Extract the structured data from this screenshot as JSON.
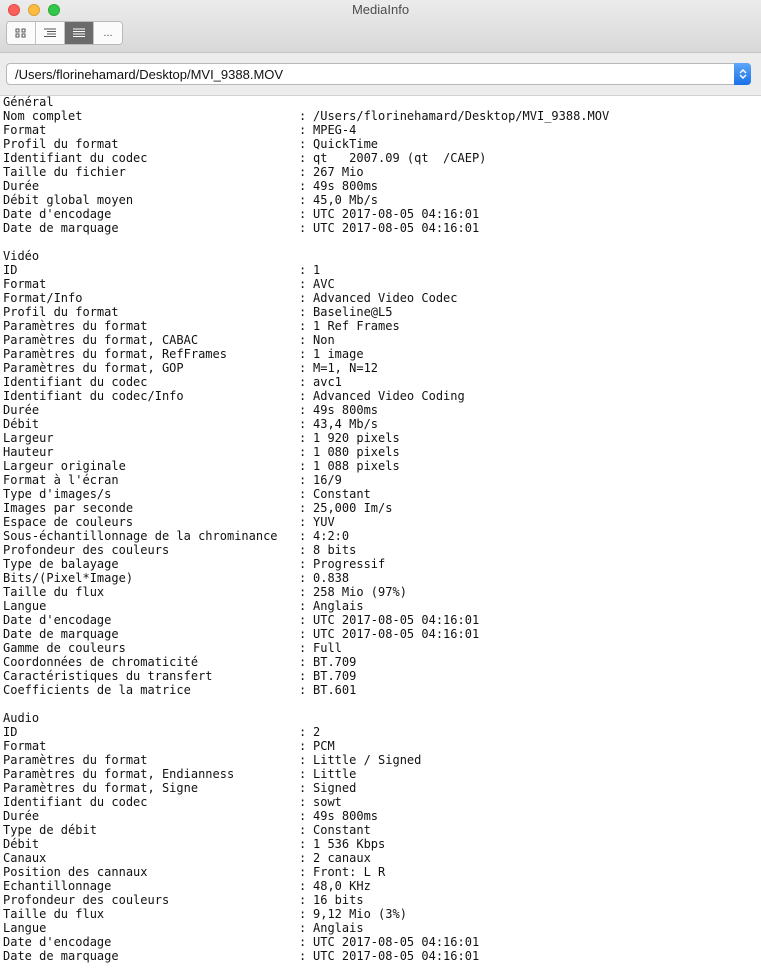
{
  "window": {
    "title": "MediaInfo"
  },
  "toolbar": {
    "more_label": "..."
  },
  "path": {
    "value": "/Users/florinehamard/Desktop/MVI_9388.MOV"
  },
  "separator": ":",
  "sections": [
    {
      "title": "Général",
      "rows": [
        [
          "Nom complet",
          "/Users/florinehamard/Desktop/MVI_9388.MOV"
        ],
        [
          "Format",
          "MPEG-4"
        ],
        [
          "Profil du format",
          "QuickTime"
        ],
        [
          "Identifiant du codec",
          "qt   2007.09 (qt  /CAEP)"
        ],
        [
          "Taille du fichier",
          "267 Mio"
        ],
        [
          "Durée",
          "49s 800ms"
        ],
        [
          "Débit global moyen",
          "45,0 Mb/s"
        ],
        [
          "Date d'encodage",
          "UTC 2017-08-05 04:16:01"
        ],
        [
          "Date de marquage",
          "UTC 2017-08-05 04:16:01"
        ]
      ]
    },
    {
      "title": "Vidéo",
      "rows": [
        [
          "ID",
          "1"
        ],
        [
          "Format",
          "AVC"
        ],
        [
          "Format/Info",
          "Advanced Video Codec"
        ],
        [
          "Profil du format",
          "Baseline@L5"
        ],
        [
          "Paramètres du format",
          "1 Ref Frames"
        ],
        [
          "Paramètres du format, CABAC",
          "Non"
        ],
        [
          "Paramètres du format, RefFrames",
          "1 image"
        ],
        [
          "Paramètres du format, GOP",
          "M=1, N=12"
        ],
        [
          "Identifiant du codec",
          "avc1"
        ],
        [
          "Identifiant du codec/Info",
          "Advanced Video Coding"
        ],
        [
          "Durée",
          "49s 800ms"
        ],
        [
          "Débit",
          "43,4 Mb/s"
        ],
        [
          "Largeur",
          "1 920 pixels"
        ],
        [
          "Hauteur",
          "1 080 pixels"
        ],
        [
          "Largeur originale",
          "1 088 pixels"
        ],
        [
          "Format à l'écran",
          "16/9"
        ],
        [
          "Type d'images/s",
          "Constant"
        ],
        [
          "Images par seconde",
          "25,000 Im/s"
        ],
        [
          "Espace de couleurs",
          "YUV"
        ],
        [
          "Sous-échantillonnage de la chrominance",
          "4:2:0"
        ],
        [
          "Profondeur des couleurs",
          "8 bits"
        ],
        [
          "Type de balayage",
          "Progressif"
        ],
        [
          "Bits/(Pixel*Image)",
          "0.838"
        ],
        [
          "Taille du flux",
          "258 Mio (97%)"
        ],
        [
          "Langue",
          "Anglais"
        ],
        [
          "Date d'encodage",
          "UTC 2017-08-05 04:16:01"
        ],
        [
          "Date de marquage",
          "UTC 2017-08-05 04:16:01"
        ],
        [
          "Gamme de couleurs",
          "Full"
        ],
        [
          "Coordonnées de chromaticité",
          "BT.709"
        ],
        [
          "Caractéristiques du transfert",
          "BT.709"
        ],
        [
          "Coefficients de la matrice",
          "BT.601"
        ]
      ]
    },
    {
      "title": "Audio",
      "rows": [
        [
          "ID",
          "2"
        ],
        [
          "Format",
          "PCM"
        ],
        [
          "Paramètres du format",
          "Little / Signed"
        ],
        [
          "Paramètres du format, Endianness",
          "Little"
        ],
        [
          "Paramètres du format, Signe",
          "Signed"
        ],
        [
          "Identifiant du codec",
          "sowt"
        ],
        [
          "Durée",
          "49s 800ms"
        ],
        [
          "Type de débit",
          "Constant"
        ],
        [
          "Débit",
          "1 536 Kbps"
        ],
        [
          "Canaux",
          "2 canaux"
        ],
        [
          "Position des cannaux",
          "Front: L R"
        ],
        [
          "Echantillonnage",
          "48,0 KHz"
        ],
        [
          "Profondeur des couleurs",
          "16 bits"
        ],
        [
          "Taille du flux",
          "9,12 Mio (3%)"
        ],
        [
          "Langue",
          "Anglais"
        ],
        [
          "Date d'encodage",
          "UTC 2017-08-05 04:16:01"
        ],
        [
          "Date de marquage",
          "UTC 2017-08-05 04:16:01"
        ]
      ]
    }
  ]
}
